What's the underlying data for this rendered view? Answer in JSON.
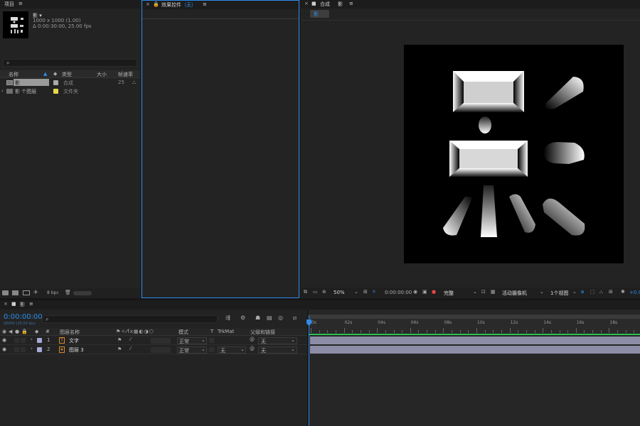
{
  "project_panel": {
    "close": "×",
    "title": "项目",
    "menu": "≡",
    "comp_name": "影 ▾",
    "comp_dims": "1000 x 1000 (1.00)",
    "comp_duration": "Δ 0:00:30:00, 25.00 fps",
    "search_icon": "search-icon",
    "columns": [
      "名称",
      "类型",
      "大小",
      "帧速率"
    ],
    "items": [
      {
        "name": "影",
        "type": "合成",
        "size": "",
        "fps": "25",
        "color": "#a9a9a9",
        "kind": "comp"
      },
      {
        "name": "影 个图层",
        "type": "文件夹",
        "size": "",
        "fps": "",
        "color": "#e6d84a",
        "kind": "folder"
      }
    ],
    "bpc": "8 bpc"
  },
  "effects_panel": {
    "close": "×",
    "title": "效果控件",
    "none_label": "（无）",
    "menu": "≡"
  },
  "composition_panel": {
    "close": "×",
    "title": "合成",
    "comp_name": "影",
    "menu": "≡",
    "breadcrumb": "影",
    "toolbar": {
      "zoom": "50%",
      "timecode": "0:00:00:00",
      "resolution": "完整",
      "camera": "活动摄像机",
      "views": "1个视图",
      "exposure": "+0.0"
    }
  },
  "timeline_panel": {
    "close": "×",
    "title": "影",
    "menu": "≡",
    "timecode": "0:00:00:00",
    "frame_info": "00000 (25.00 fps)",
    "columns": {
      "hash": "#",
      "layer_name": "图层名称",
      "mode": "模式",
      "t": "T",
      "trkmat": "TrkMat",
      "parent": "父级和链接"
    },
    "layers": [
      {
        "index": "1",
        "name": "文字",
        "mode": "正常",
        "trkmat": "",
        "parent": "无",
        "color": "#a8a8d6"
      },
      {
        "index": "2",
        "name": "图层 3",
        "mode": "正常",
        "trkmat": "无",
        "parent": "无",
        "color": "#a8a8d6"
      }
    ],
    "ruler_labels": [
      "0s",
      "02s",
      "04s",
      "06s",
      "08s",
      "10s",
      "12s",
      "14s",
      "16s",
      "18s",
      "2"
    ]
  },
  "colors": {
    "accent": "#2d8ceb",
    "work_area": "#2fbf5a",
    "layer_bar": "#8d8da8"
  }
}
